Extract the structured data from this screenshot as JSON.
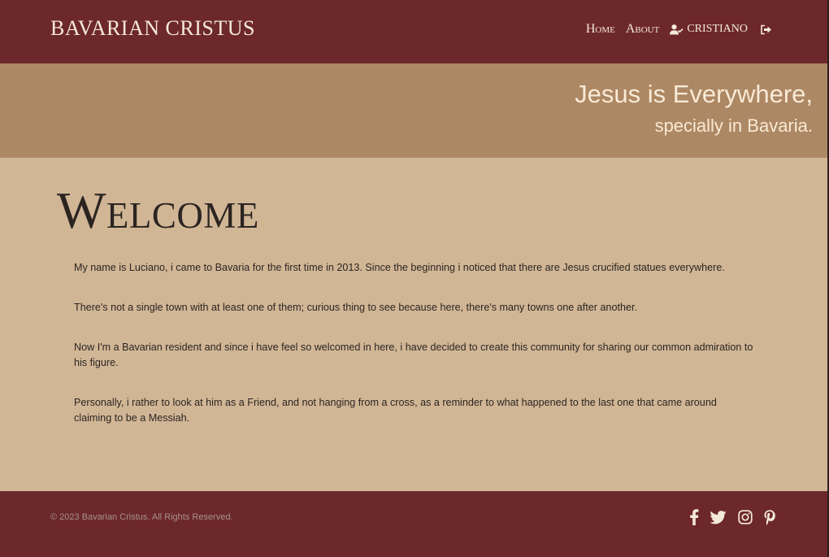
{
  "header": {
    "brand": "BAVARIAN CRISTUS",
    "nav": {
      "home": "Home",
      "about": "About",
      "user": "CRISTIANO"
    }
  },
  "hero": {
    "line1": "Jesus is Everywhere,",
    "line2": "specially in Bavaria."
  },
  "main": {
    "title": "Welcome",
    "paragraphs": [
      "My name is Luciano, i came to Bavaria for the first time in 2013. Since the beginning i noticed that there are Jesus crucified statues everywhere.",
      "There's not a single town with at least one of them; curious thing to see because here, there's many towns one after another.",
      "Now I'm a Bavarian resident and since i have feel so welcomed in here, i have decided to create this community for sharing our common admiration to his figure.",
      "Personally, i rather to look at him as a Friend, and not hanging from a cross, as a reminder to what happened to the last one that came around claiming to be a Messiah."
    ]
  },
  "footer": {
    "copyright": "© 2023 Bavarian Cristus. All Rights Reserved.",
    "social_icons": [
      "facebook-icon",
      "twitter-icon",
      "instagram-icon",
      "pinterest-icon"
    ]
  },
  "colors": {
    "nav_bg": "#6d282b",
    "hero_bg": "#ad8864",
    "page_bg": "#d1b696",
    "light_text": "#f4ead8",
    "dark_text": "#2b2521"
  }
}
